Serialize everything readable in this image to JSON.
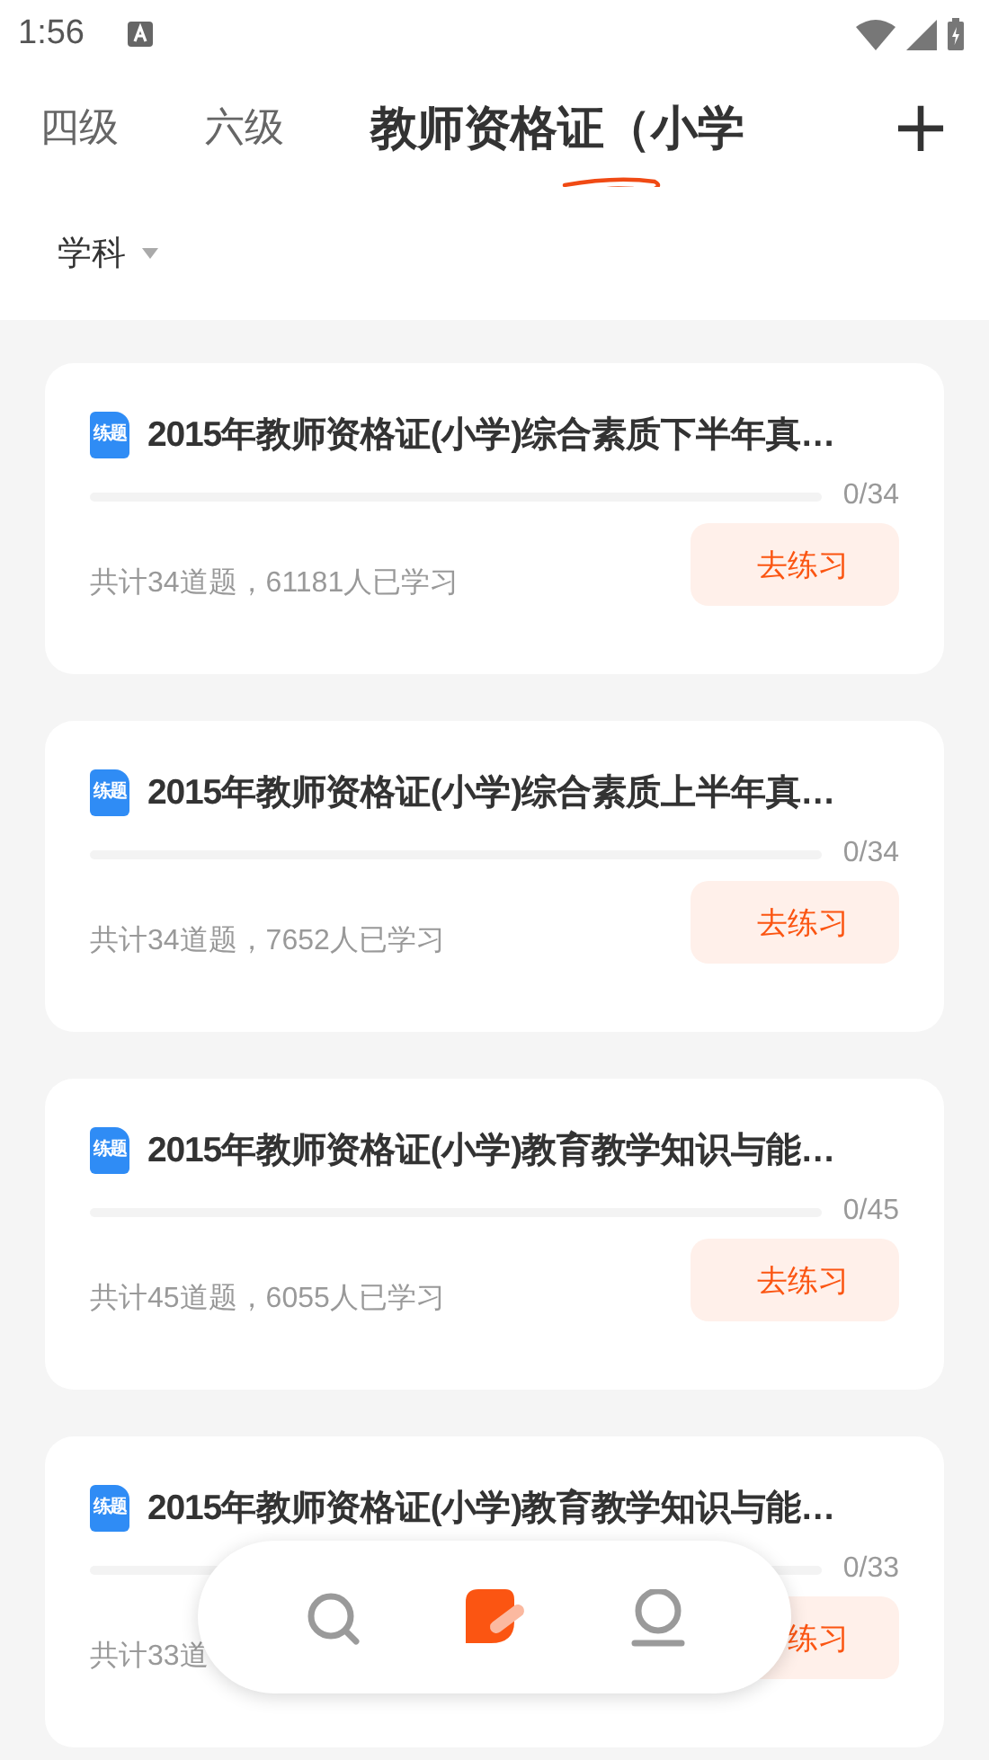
{
  "status_bar": {
    "time": "1:56"
  },
  "tabs": [
    {
      "label": "四级",
      "selected": false
    },
    {
      "label": "六级",
      "selected": false
    },
    {
      "label": "教师资格证（小学",
      "selected": true
    }
  ],
  "add_button": "+",
  "filter": {
    "label": "学科"
  },
  "cards": [
    {
      "badge": "练题",
      "title": "2015年教师资格证(小学)综合素质下半年真…",
      "progress": "0/34",
      "stats": "共计34道题，61181人已学习",
      "button": "去练习"
    },
    {
      "badge": "练题",
      "title": "2015年教师资格证(小学)综合素质上半年真…",
      "progress": "0/34",
      "stats": "共计34道题，7652人已学习",
      "button": "去练习"
    },
    {
      "badge": "练题",
      "title": "2015年教师资格证(小学)教育教学知识与能…",
      "progress": "0/45",
      "stats": "共计45道题，6055人已学习",
      "button": "去练习"
    },
    {
      "badge": "练题",
      "title": "2015年教师资格证(小学)教育教学知识与能…",
      "progress": "0/33",
      "stats": "共计33道",
      "button": "练习"
    }
  ],
  "bottom_nav": [
    {
      "kind": "search",
      "selected": false
    },
    {
      "kind": "practice",
      "selected": true
    },
    {
      "kind": "profile",
      "selected": false
    }
  ]
}
